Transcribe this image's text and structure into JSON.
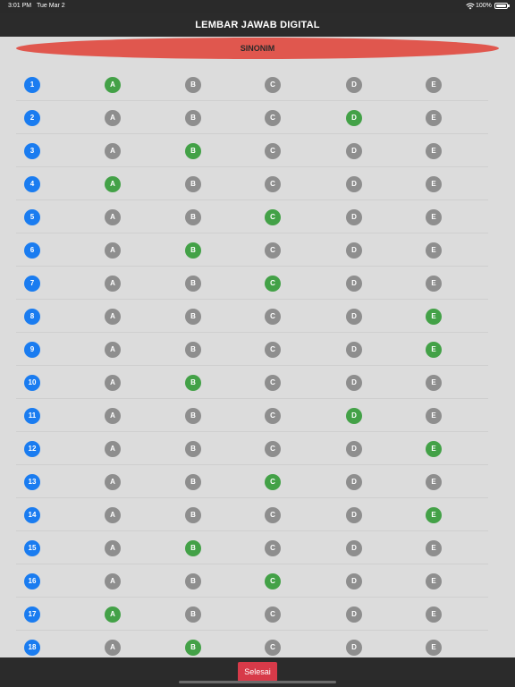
{
  "status_bar": {
    "time": "3:01 PM",
    "date": "Tue Mar 2",
    "battery": "100%",
    "wifi_icon": "wifi-icon",
    "battery_icon": "battery-icon"
  },
  "navbar": {
    "title": "LEMBAR JAWAB DIGITAL"
  },
  "section": {
    "title": "SINONIM"
  },
  "option_labels": [
    "A",
    "B",
    "C",
    "D",
    "E"
  ],
  "questions": [
    {
      "number": "1",
      "selected": "A"
    },
    {
      "number": "2",
      "selected": "D"
    },
    {
      "number": "3",
      "selected": "B"
    },
    {
      "number": "4",
      "selected": "A"
    },
    {
      "number": "5",
      "selected": "C"
    },
    {
      "number": "6",
      "selected": "B"
    },
    {
      "number": "7",
      "selected": "C"
    },
    {
      "number": "8",
      "selected": "E"
    },
    {
      "number": "9",
      "selected": "E"
    },
    {
      "number": "10",
      "selected": "B"
    },
    {
      "number": "11",
      "selected": "D"
    },
    {
      "number": "12",
      "selected": "E"
    },
    {
      "number": "13",
      "selected": "C"
    },
    {
      "number": "14",
      "selected": "E"
    },
    {
      "number": "15",
      "selected": "B"
    },
    {
      "number": "16",
      "selected": "C"
    },
    {
      "number": "17",
      "selected": "A"
    },
    {
      "number": "18",
      "selected": "B"
    }
  ],
  "footer": {
    "done_label": "Selesai"
  },
  "colors": {
    "number_circle": "#1a7cf0",
    "selected": "#43a147",
    "unselected": "#8e8e8e",
    "header": "#e0574e",
    "done_button": "#d73a49"
  }
}
